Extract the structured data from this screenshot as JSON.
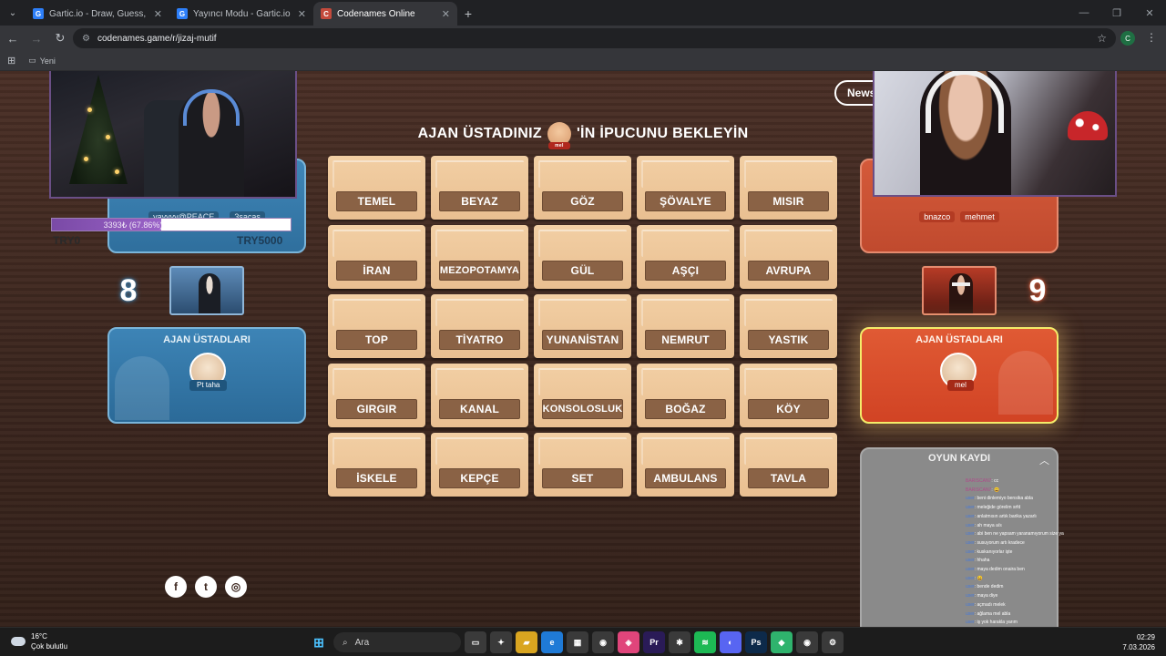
{
  "browser": {
    "tabs": [
      {
        "title": "Gartic.io - Draw, Guess, WIN",
        "favicon": "G",
        "color": "#2d7ff9",
        "active": false
      },
      {
        "title": "Yayıncı Modu - Gartic.io",
        "favicon": "G",
        "color": "#2d7ff9",
        "active": false
      },
      {
        "title": "Codenames Online",
        "favicon": "C",
        "color": "#c44a3c",
        "active": true
      }
    ],
    "url": "codenames.game/r/jizaj-mutif",
    "bookmark_folder": "Yeni",
    "profile_initial": "C"
  },
  "game": {
    "news_label": "News",
    "header_before": "AJAN ÜSTADINIZ",
    "header_after": "'İN İPUCUNU BEKLEYİN",
    "header_avatar_name": "mel",
    "cards": [
      "TEMEL",
      "BEYAZ",
      "GÖZ",
      "ŞÖVALYE",
      "MISIR",
      "İRAN",
      "MEZOPOTAMYA",
      "GÜL",
      "AŞÇI",
      "AVRUPA",
      "TOP",
      "TİYATRO",
      "YUNANİSTAN",
      "NEMRUT",
      "YASTIK",
      "GIRGIR",
      "KANAL",
      "KONSOLOSLUK",
      "BOĞAZ",
      "KÖY",
      "İSKELE",
      "KEPÇE",
      "SET",
      "AMBULANS",
      "TAVLA"
    ],
    "blue": {
      "members": [
        "yayyyy@PEACE",
        "3sacas"
      ],
      "progress_text": "3393₺ (67.86%)",
      "progress_fraction": 0.6786,
      "try_left": "TRY0",
      "try_right": "TRY5000",
      "remaining": "8",
      "spymaster_title": "AJAN ÜSTADLARI",
      "spymaster_name": "Pt taha"
    },
    "red": {
      "members": [
        "bnazco",
        "mehmet"
      ],
      "remaining": "9",
      "spymaster_title": "AJAN ÜSTADLARI",
      "spymaster_name": "mel"
    },
    "log": {
      "title": "OYUN KAYDI",
      "chat": [
        {
          "user": "BARISCAN7",
          "msg": ": cc"
        },
        {
          "user": "BARISCAN7",
          "msg": ": 😀"
        },
        {
          "user": "user",
          "msg": ": beni dinlemiyo bensika abla"
        },
        {
          "user": "user",
          "msg": ": meleğide görelim srfd"
        },
        {
          "user": "user",
          "msg": ": anlatmısın artık barika yazarlı"
        },
        {
          "user": "user",
          "msg": ": ah maya a/s"
        },
        {
          "user": "user",
          "msg": ": abi ben ne yapsam yaranamıyorum size ya"
        },
        {
          "user": "user",
          "msg": ": susuyorum artı kradece"
        },
        {
          "user": "user",
          "msg": ": kuskanıyorlar işte"
        },
        {
          "user": "user",
          "msg": ": hhaha"
        },
        {
          "user": "user",
          "msg": ": maya dedim onaira ben"
        },
        {
          "user": "user",
          "msg": ": 😀"
        },
        {
          "user": "user",
          "msg": ": bende dedim"
        },
        {
          "user": "user",
          "msg": ": maya diye"
        },
        {
          "user": "user",
          "msg": ": açmadı melek"
        },
        {
          "user": "user",
          "msg": ": ağlama mel abla"
        },
        {
          "user": "user",
          "msg": ": iş yok harakla yarım"
        }
      ]
    },
    "social": [
      "f",
      "t",
      "◎"
    ]
  },
  "taskbar": {
    "weather_temp": "16°C",
    "weather_desc": "Çok bulutlu",
    "search_placeholder": "Ara",
    "time": "02:29",
    "date": "7.03.2026",
    "apps": [
      {
        "name": "task-view-icon",
        "glyph": "▭",
        "color": "#3a3a3a"
      },
      {
        "name": "copilot-icon",
        "glyph": "✦",
        "color": "#3a3a3a"
      },
      {
        "name": "file-explorer-icon",
        "glyph": "▰",
        "color": "#d9a520"
      },
      {
        "name": "edge-icon",
        "glyph": "e",
        "color": "#1f7ad6"
      },
      {
        "name": "store-icon",
        "glyph": "▦",
        "color": "#3a3a3a"
      },
      {
        "name": "chrome-icon",
        "glyph": "◉",
        "color": "#3a3a3a"
      },
      {
        "name": "photos-icon",
        "glyph": "◈",
        "color": "#e0457b"
      },
      {
        "name": "premiere-icon",
        "glyph": "Pr",
        "color": "#2a1b57"
      },
      {
        "name": "pinwheel-icon",
        "glyph": "✱",
        "color": "#3a3a3a"
      },
      {
        "name": "spotify-icon",
        "glyph": "≋",
        "color": "#1db954"
      },
      {
        "name": "discord-icon",
        "glyph": "◐",
        "color": "#5865f2"
      },
      {
        "name": "photoshop-icon",
        "glyph": "Ps",
        "color": "#0d2a4a"
      },
      {
        "name": "app-green-icon",
        "glyph": "◆",
        "color": "#2fb36d"
      },
      {
        "name": "chrome-profile-icon",
        "glyph": "◉",
        "color": "#3a3a3a"
      },
      {
        "name": "settings-icon",
        "glyph": "⚙",
        "color": "#3a3a3a"
      }
    ]
  }
}
